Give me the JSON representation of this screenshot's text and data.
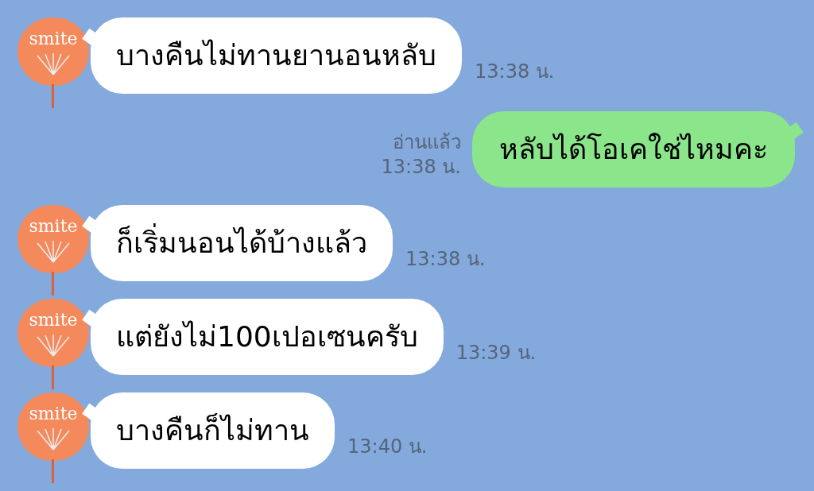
{
  "messages": [
    {
      "kind": "incoming",
      "avatar_text": "smite",
      "text": "บางคืนไม่ทานยานอนหลับ",
      "time": "13:38 น."
    },
    {
      "kind": "outgoing",
      "read": "อ่านแล้ว",
      "text": "หลับได้โอเคใช่ไหมคะ",
      "time": "13:38 น."
    },
    {
      "kind": "incoming",
      "avatar_text": "smite",
      "text": "ก็เริ่มนอนได้บ้างแล้ว",
      "time": "13:38 น."
    },
    {
      "kind": "incoming",
      "avatar_text": "smite",
      "text": "แต่ยังไม่100เปอเซนครับ",
      "time": "13:39 น."
    },
    {
      "kind": "incoming",
      "avatar_text": "smite",
      "text": "บางคืนก็ไม่ทาน",
      "time": "13:40 น."
    }
  ]
}
